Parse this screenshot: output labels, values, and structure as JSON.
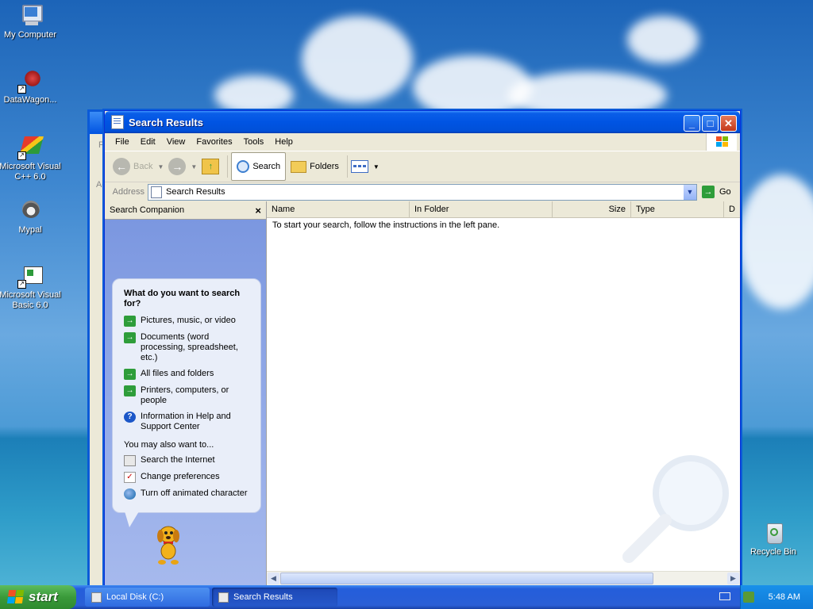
{
  "desktop": {
    "icons": [
      {
        "label": "My Computer"
      },
      {
        "label": "DataWagon..."
      },
      {
        "label": "Microsoft Visual C++ 6.0"
      },
      {
        "label": "Mypal"
      },
      {
        "label": "Microsoft Visual Basic 6.0"
      },
      {
        "label": "Recycle Bin"
      }
    ]
  },
  "window": {
    "title": "Search Results",
    "menu": [
      "File",
      "Edit",
      "View",
      "Favorites",
      "Tools",
      "Help"
    ],
    "toolbar": {
      "back": "Back",
      "search": "Search",
      "folders": "Folders"
    },
    "address": {
      "label": "Address",
      "value": "Search Results",
      "go": "Go"
    },
    "companion": {
      "title": "Search Companion",
      "close": "×",
      "question": "What do you want to search for?",
      "options": [
        {
          "label": "Pictures, music, or video",
          "icon": "green-arrow-icon"
        },
        {
          "label": "Documents (word processing, spreadsheet, etc.)",
          "icon": "green-arrow-icon"
        },
        {
          "label": "All files and folders",
          "icon": "green-arrow-icon"
        },
        {
          "label": "Printers, computers, or people",
          "icon": "green-arrow-icon"
        },
        {
          "label": "Information in Help and Support Center",
          "icon": "help-icon"
        }
      ],
      "also_heading": "You may also want to...",
      "also": [
        {
          "label": "Search the Internet",
          "icon": "search-internet-icon"
        },
        {
          "label": "Change preferences",
          "icon": "checklist-icon"
        },
        {
          "label": "Turn off animated character",
          "icon": "globe-icon"
        }
      ]
    },
    "results": {
      "columns": [
        "Name",
        "In Folder",
        "Size",
        "Type",
        "D"
      ],
      "empty_message": "To start your search, follow the instructions in the left pane."
    }
  },
  "bg_window_fragment": {
    "menu_letter": "Fi",
    "address_letters": "Ad"
  },
  "taskbar": {
    "start": "start",
    "tasks": [
      "Local Disk (C:)",
      "Search Results"
    ],
    "clock": "5:48 AM"
  },
  "colors": {
    "titlebar": "#0054e3",
    "taskbar": "#245edb",
    "start_button": "#3a9a3a",
    "companion_pane": "#7a96df"
  }
}
